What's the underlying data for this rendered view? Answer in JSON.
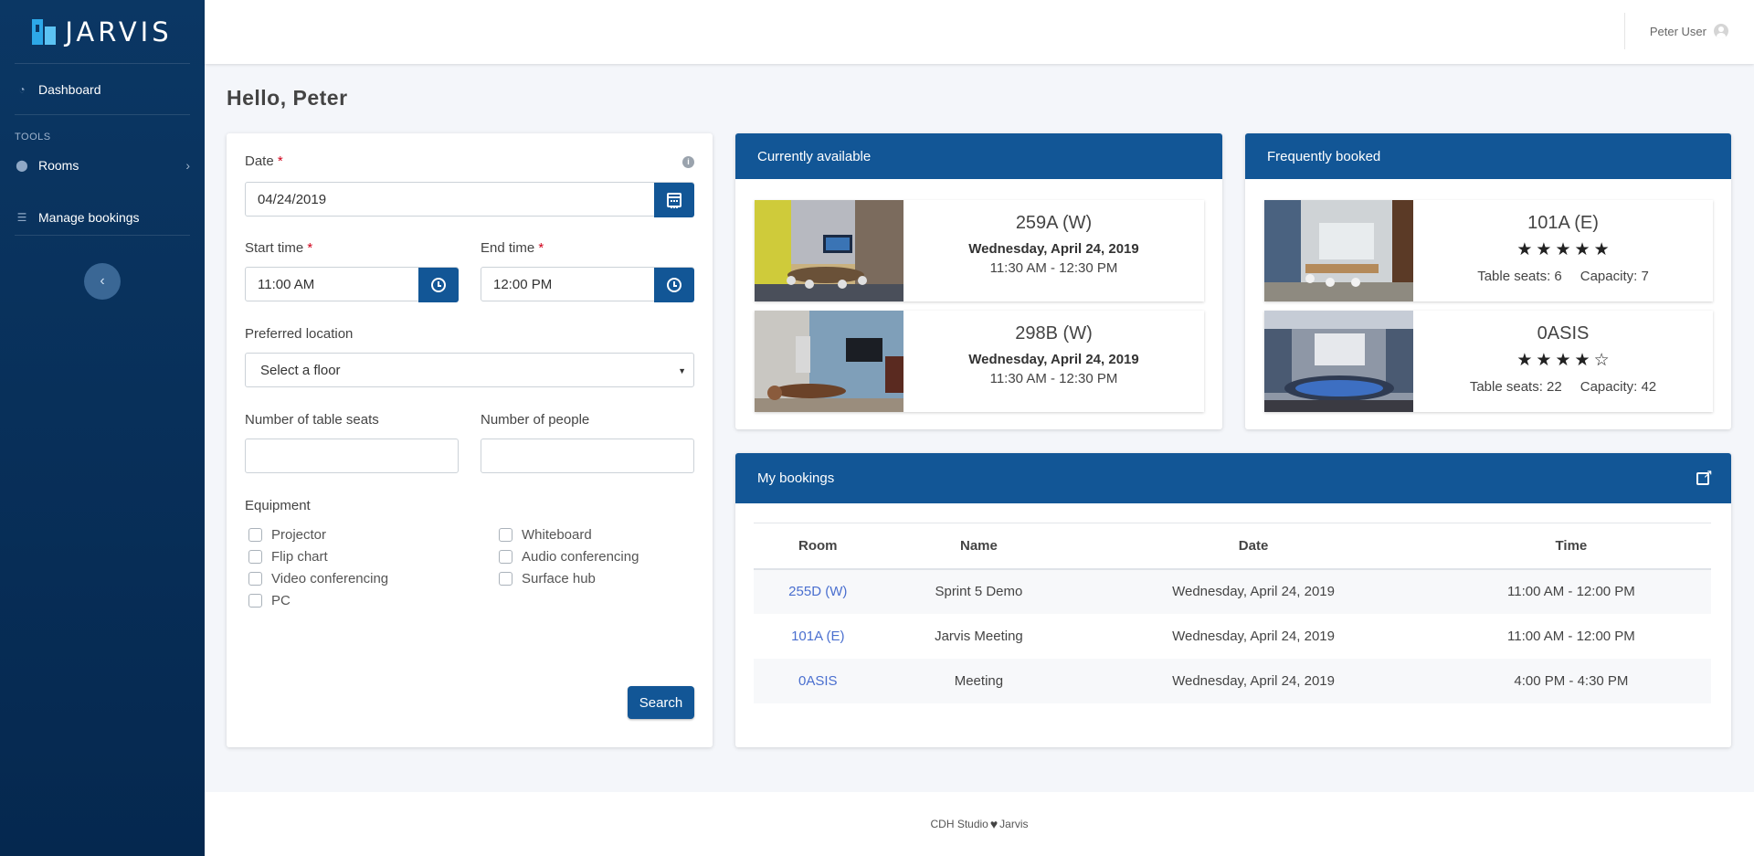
{
  "brand": {
    "name": "JARVIS"
  },
  "sidebar": {
    "dashboard": "Dashboard",
    "section_tools": "TOOLS",
    "rooms": "Rooms",
    "manage_bookings": "Manage bookings",
    "collapse_glyph": "‹"
  },
  "header": {
    "user_name": "Peter User"
  },
  "greeting": "Hello, Peter",
  "search_form": {
    "date_label": "Date",
    "date_value": "04/24/2019",
    "start_label": "Start time",
    "start_value": "11:00 AM",
    "end_label": "End time",
    "end_value": "12:00 PM",
    "location_label": "Preferred location",
    "location_value": "Select a floor",
    "seats_label": "Number of table seats",
    "people_label": "Number of people",
    "equipment_label": "Equipment",
    "equipment": [
      "Projector",
      "Flip chart",
      "Video conferencing",
      "PC",
      "Whiteboard",
      "Audio conferencing",
      "Surface hub"
    ],
    "search_button": "Search",
    "required_mark": "*",
    "info_glyph": "i"
  },
  "currently_available": {
    "title": "Currently available",
    "rooms": [
      {
        "name": "259A (W)",
        "date": "Wednesday, April 24, 2019",
        "time": "11:30 AM - 12:30 PM"
      },
      {
        "name": "298B (W)",
        "date": "Wednesday, April 24, 2019",
        "time": "11:30 AM - 12:30 PM"
      }
    ]
  },
  "frequently_booked": {
    "title": "Frequently booked",
    "rooms": [
      {
        "name": "101A (E)",
        "rating": 5,
        "seats_text": "Table seats: 6",
        "capacity_text": "Capacity: 7"
      },
      {
        "name": "0ASIS",
        "rating": 4,
        "seats_text": "Table seats: 22",
        "capacity_text": "Capacity: 42"
      }
    ]
  },
  "my_bookings": {
    "title": "My bookings",
    "columns": [
      "Room",
      "Name",
      "Date",
      "Time"
    ],
    "rows": [
      {
        "room": "255D (W)",
        "name": "Sprint 5 Demo",
        "date": "Wednesday, April 24, 2019",
        "time": "11:00 AM - 12:00 PM"
      },
      {
        "room": "101A (E)",
        "name": "Jarvis Meeting",
        "date": "Wednesday, April 24, 2019",
        "time": "11:00 AM - 12:00 PM"
      },
      {
        "room": "0ASIS",
        "name": "Meeting",
        "date": "Wednesday, April 24, 2019",
        "time": "4:00 PM - 4:30 PM"
      }
    ]
  },
  "footer": {
    "left": "CDH Studio",
    "right": "Jarvis"
  },
  "colors": {
    "primary": "#125696",
    "sidebar": "#0b3764",
    "link": "#4a6fcf",
    "required": "#d0021b"
  },
  "icons": [
    "dashboard-icon",
    "map-pin-icon",
    "list-icon",
    "chevron-right-icon",
    "chevron-left-icon",
    "calendar-icon",
    "clock-icon",
    "info-icon",
    "external-link-icon",
    "user-avatar-icon",
    "heart-icon",
    "star-icon"
  ]
}
